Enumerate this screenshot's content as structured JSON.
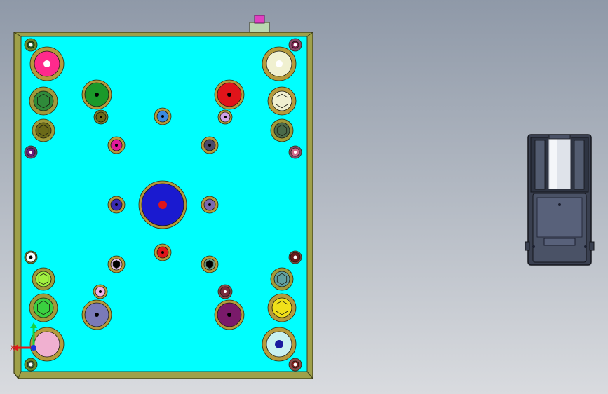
{
  "viewport": {
    "background_top": "#8f99a8",
    "background_bottom": "#d9dbdf"
  },
  "plate": {
    "face_color": "#00ffff",
    "frame_color": "#9fa049",
    "edge_color": "#3a3a18"
  },
  "triad": {
    "x_label": "X",
    "x_color": "#e01818",
    "y_color": "#18d040",
    "z_color": "#1830e0"
  },
  "holes": [
    {
      "id": "tl-small",
      "ring": "#6b8a2a",
      "inner": "#1f5a22",
      "dot": "#ffffff",
      "shape": "circle"
    },
    {
      "id": "tl-large",
      "ring": "#b59a3c",
      "inner": "#ff2a8c",
      "dot": "#ffffff",
      "shape": "circle"
    },
    {
      "id": "tl-hex-1",
      "ring": "#a09a3a",
      "inner": "#2f8a3a",
      "dot": "#2f8a3a",
      "shape": "hex"
    },
    {
      "id": "tl-hex-2",
      "ring": "#a09a3a",
      "inner": "#6b6a18",
      "dot": "#6b6a18",
      "shape": "hex"
    },
    {
      "id": "tl-tiny",
      "ring": "#6b3a6b",
      "inner": "#6a1a7a",
      "dot": "#ffffff",
      "shape": "circle"
    },
    {
      "id": "c-green-1",
      "ring": "#b59a3c",
      "inner": "#1a9a2a",
      "dot": "#000000",
      "shape": "circle"
    },
    {
      "id": "c-olive",
      "ring": "#7a7a2a",
      "inner": "#6b6a18",
      "dot": "#000000",
      "shape": "circle"
    },
    {
      "id": "c-blue-top",
      "ring": "#b59a3c",
      "inner": "#3a8ae0",
      "dot": "#000000",
      "shape": "circle"
    },
    {
      "id": "c-magenta",
      "ring": "#b59a3c",
      "inner": "#e01a9a",
      "dot": "#000000",
      "shape": "circle"
    },
    {
      "id": "tr-red",
      "ring": "#b59a3c",
      "inner": "#e0141a",
      "dot": "#000000",
      "shape": "circle"
    },
    {
      "id": "tr-lilac",
      "ring": "#b59a3c",
      "inner": "#d0a0e8",
      "dot": "#000000",
      "shape": "circle"
    },
    {
      "id": "tr-slate",
      "ring": "#b59a3c",
      "inner": "#4a4a6a",
      "dot": "#000000",
      "shape": "circle"
    },
    {
      "id": "tr-small",
      "ring": "#8a4a6a",
      "inner": "#7a1a4a",
      "dot": "#ffffff",
      "shape": "circle"
    },
    {
      "id": "tr-large",
      "ring": "#b59a3c",
      "inner": "#f0f0d0",
      "dot": "#ffffff",
      "shape": "circle"
    },
    {
      "id": "tr-hex-1",
      "ring": "#b59a3c",
      "inner": "#f0f0d0",
      "dot": "#f0f0d0",
      "shape": "hex"
    },
    {
      "id": "tr-hex-2",
      "ring": "#a09a3a",
      "inner": "#4a6a4a",
      "dot": "#4a6a4a",
      "shape": "hex"
    },
    {
      "id": "tr-tiny",
      "ring": "#8a4a6a",
      "inner": "#d06a8a",
      "dot": "#ffffff",
      "shape": "circle"
    },
    {
      "id": "center-big",
      "ring": "#b59a3c",
      "inner": "#1a1ad0",
      "dot": "#e0141a",
      "shape": "circle"
    },
    {
      "id": "center-left",
      "ring": "#b59a3c",
      "inner": "#3a2ab0",
      "dot": "#000000",
      "shape": "circle"
    },
    {
      "id": "center-right",
      "ring": "#b59a3c",
      "inner": "#7a6ab0",
      "dot": "#000000",
      "shape": "circle"
    },
    {
      "id": "center-red",
      "ring": "#b59a3c",
      "inner": "#e0141a",
      "dot": "#000000",
      "shape": "circle"
    },
    {
      "id": "bl-white",
      "ring": "#7a7a2a",
      "inner": "#ffffff",
      "dot": "#000000",
      "shape": "circle"
    },
    {
      "id": "bl-hex-1",
      "ring": "#a09a3a",
      "inner": "#a0f040",
      "dot": "#a0f040",
      "shape": "hex"
    },
    {
      "id": "bl-lilac",
      "ring": "#b59a3c",
      "inner": "#e0c0e8",
      "dot": "#000000",
      "shape": "hex"
    },
    {
      "id": "bl-pink-small",
      "ring": "#b59a3c",
      "inner": "#f0b0e8",
      "dot": "#000000",
      "shape": "circle"
    },
    {
      "id": "bl-hex-2",
      "ring": "#a09a3a",
      "inner": "#3ad040",
      "dot": "#3ad040",
      "shape": "hex"
    },
    {
      "id": "bl-purple",
      "ring": "#b59a3c",
      "inner": "#7a7ab8",
      "dot": "#000000",
      "shape": "circle"
    },
    {
      "id": "bl-large",
      "ring": "#b59a3c",
      "inner": "#f0b0d0",
      "dot": "#f0b0d0",
      "shape": "circle"
    },
    {
      "id": "bl-small",
      "ring": "#6b8a2a",
      "inner": "#3a5a3a",
      "dot": "#ffffff",
      "shape": "circle"
    },
    {
      "id": "br-sage",
      "ring": "#b59a3c",
      "inner": "#70a088",
      "dot": "#000000",
      "shape": "hex"
    },
    {
      "id": "br-brown",
      "ring": "#8a4a4a",
      "inner": "#7a2a3a",
      "dot": "#ffffff",
      "shape": "circle"
    },
    {
      "id": "br-plum",
      "ring": "#b59a3c",
      "inner": "#7a1a6a",
      "dot": "#000000",
      "shape": "circle"
    },
    {
      "id": "br-small",
      "ring": "#8a4a4a",
      "inner": "#6a1a1a",
      "dot": "#ffffff",
      "shape": "circle"
    },
    {
      "id": "br-hex-1",
      "ring": "#a09a3a",
      "inner": "#60a0a0",
      "dot": "#60a0a0",
      "shape": "hex"
    },
    {
      "id": "br-yellow",
      "ring": "#b59a3c",
      "inner": "#f0e01a",
      "dot": "#f0e01a",
      "shape": "hex"
    },
    {
      "id": "br-large",
      "ring": "#b59a3c",
      "inner": "#c8f0f0",
      "dot": "#1a1aa0",
      "shape": "circle"
    },
    {
      "id": "br-corner",
      "ring": "#8a4a4a",
      "inner": "#7a1a1a",
      "dot": "#ffffff",
      "shape": "circle"
    }
  ],
  "part_view": {
    "body_color": "#3a4050",
    "edge_color": "#14161c",
    "face_color": "#4a5266",
    "highlight_color": "#dfe3ea"
  }
}
